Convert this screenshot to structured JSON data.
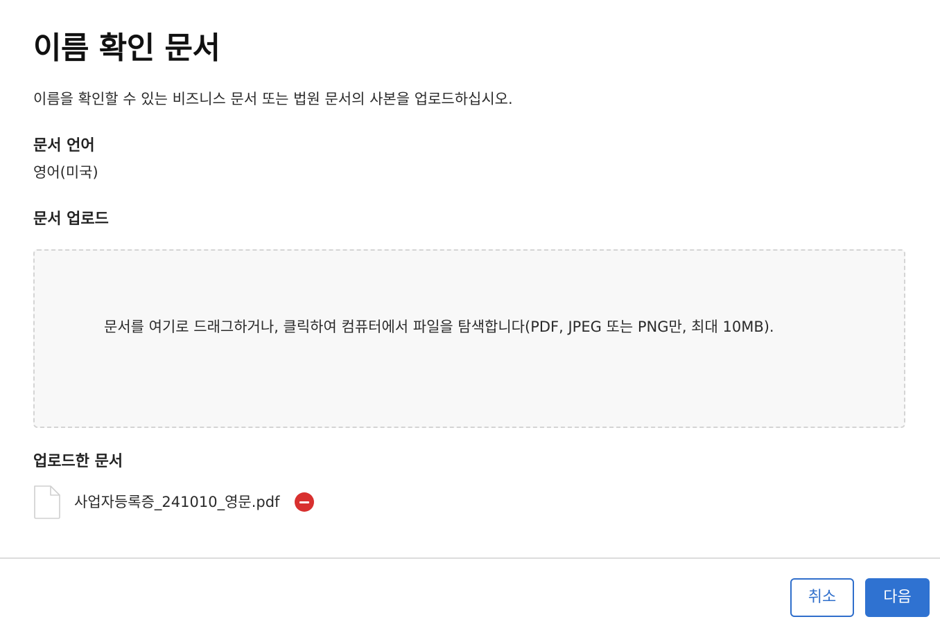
{
  "header": {
    "title": "이름 확인 문서",
    "description": "이름을 확인할 수 있는 비즈니스 문서 또는 법원 문서의 사본을 업로드하십시오."
  },
  "language": {
    "label": "문서 언어",
    "value": "영어(미국)"
  },
  "upload": {
    "label": "문서 업로드",
    "dropzone_text": "문서를 여기로 드래그하거나, 클릭하여 컴퓨터에서 파일을 탐색합니다(PDF, JPEG 또는 PNG만, 최대 10MB)."
  },
  "uploaded": {
    "label": "업로드한 문서",
    "files": [
      {
        "name": "사업자등록증_241010_영문.pdf",
        "icon": "document-icon",
        "action_icon": "remove-icon"
      }
    ]
  },
  "footer": {
    "cancel_label": "취소",
    "next_label": "다음"
  },
  "colors": {
    "accent": "#2f72d1",
    "danger": "#d8302f",
    "dropzone_bg": "#f8f8f8"
  }
}
